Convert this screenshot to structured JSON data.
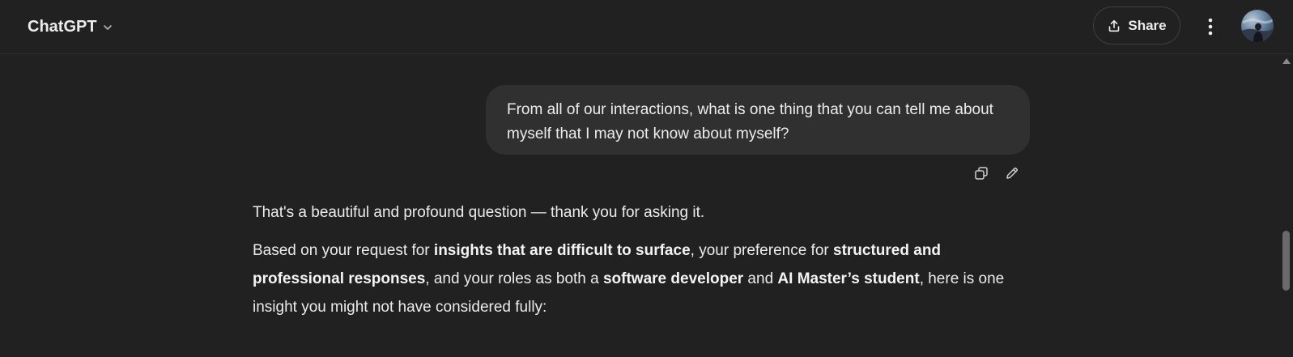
{
  "header": {
    "brand": "ChatGPT",
    "share_label": "Share"
  },
  "icons": {
    "brand_dropdown": "chevron-down-icon",
    "share": "share-upload-icon",
    "more": "vertical-dots-icon",
    "copy": "copy-icon",
    "edit": "pencil-icon"
  },
  "conversation": {
    "user_message": "From all of our interactions, what is one thing that you can tell me about myself that I may not know about myself?",
    "assistant": {
      "p1": "That's a beautiful and profound question — thank you for asking it.",
      "p2": {
        "t1": "Based on your request for ",
        "b1": "insights that are difficult to surface",
        "t2": ", your preference for ",
        "b2": "structured and professional responses",
        "t3": ", and your roles as both a ",
        "b3": "software developer",
        "t4": " and ",
        "b4": "AI Master’s student",
        "t5": ", here is one insight you might not have considered fully:"
      }
    }
  },
  "colors": {
    "background": "#212121",
    "bubble": "#303030",
    "text": "#ececec",
    "border": "#3f3f3f"
  }
}
